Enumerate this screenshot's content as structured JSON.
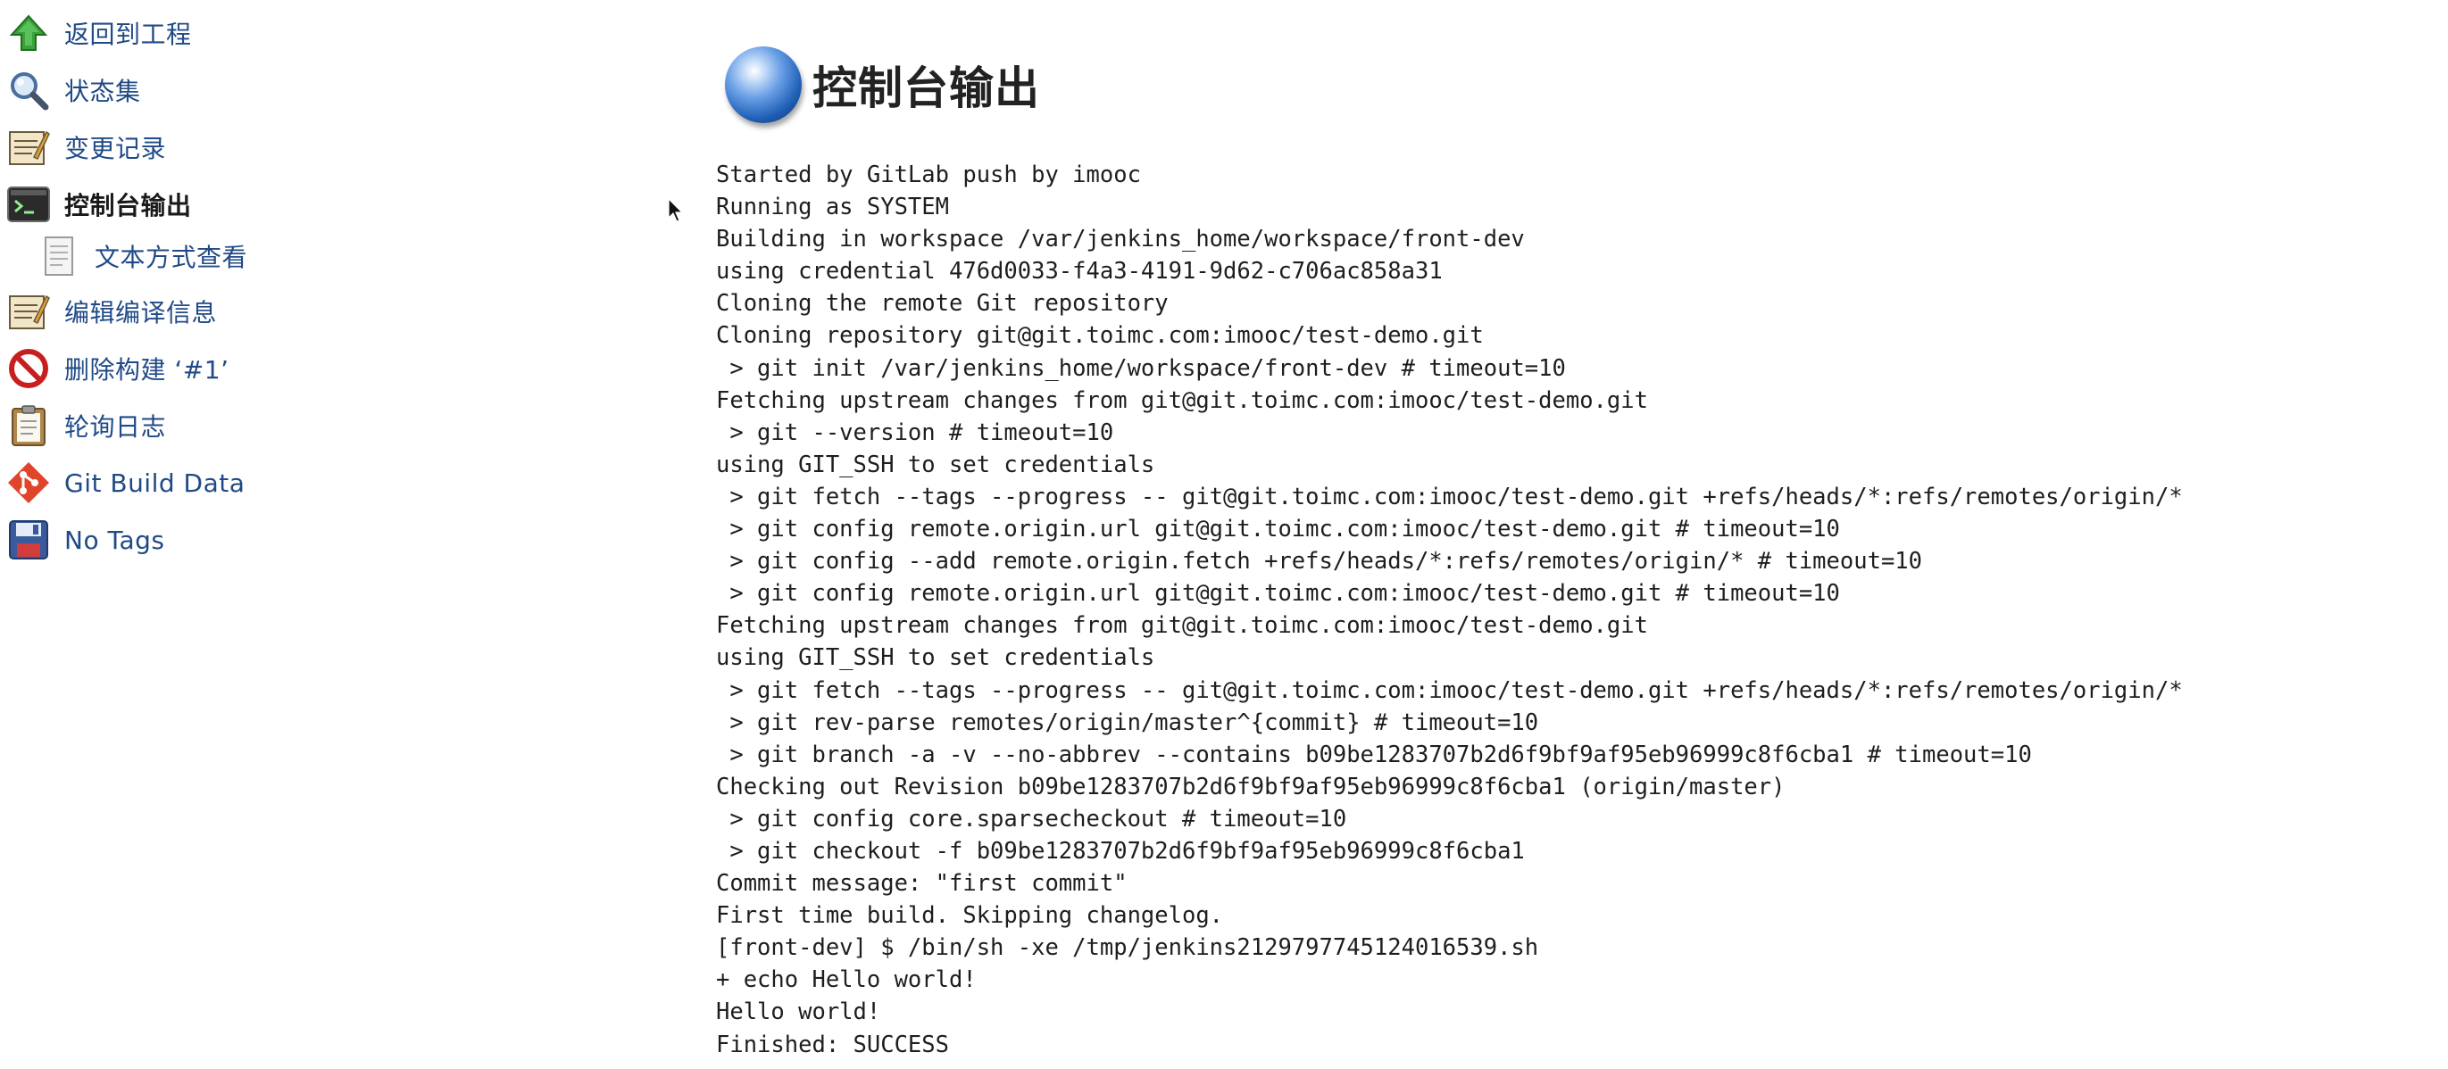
{
  "sidebar": {
    "items": [
      {
        "label": "返回到工程",
        "icon": "arrow-up-icon"
      },
      {
        "label": "状态集",
        "icon": "search-icon"
      },
      {
        "label": "变更记录",
        "icon": "notepad-icon"
      },
      {
        "label": "控制台输出",
        "icon": "terminal-icon",
        "active": true
      },
      {
        "label": "文本方式查看",
        "icon": "document-icon"
      },
      {
        "label": "编辑编译信息",
        "icon": "notepad-icon"
      },
      {
        "label": "删除构建 ‘#1’",
        "icon": "no-entry-icon"
      },
      {
        "label": "轮询日志",
        "icon": "clipboard-icon"
      },
      {
        "label": "Git Build Data",
        "icon": "git-icon"
      },
      {
        "label": "No Tags",
        "icon": "save-icon"
      }
    ]
  },
  "main": {
    "title": "控制台输出",
    "console_lines": [
      "Started by GitLab push by imooc",
      "Running as SYSTEM",
      "Building in workspace /var/jenkins_home/workspace/front-dev",
      "using credential 476d0033-f4a3-4191-9d62-c706ac858a31",
      "Cloning the remote Git repository",
      "Cloning repository git@git.toimc.com:imooc/test-demo.git",
      " > git init /var/jenkins_home/workspace/front-dev # timeout=10",
      "Fetching upstream changes from git@git.toimc.com:imooc/test-demo.git",
      " > git --version # timeout=10",
      "using GIT_SSH to set credentials",
      " > git fetch --tags --progress -- git@git.toimc.com:imooc/test-demo.git +refs/heads/*:refs/remotes/origin/*",
      " > git config remote.origin.url git@git.toimc.com:imooc/test-demo.git # timeout=10",
      " > git config --add remote.origin.fetch +refs/heads/*:refs/remotes/origin/* # timeout=10",
      " > git config remote.origin.url git@git.toimc.com:imooc/test-demo.git # timeout=10",
      "Fetching upstream changes from git@git.toimc.com:imooc/test-demo.git",
      "using GIT_SSH to set credentials",
      " > git fetch --tags --progress -- git@git.toimc.com:imooc/test-demo.git +refs/heads/*:refs/remotes/origin/*",
      " > git rev-parse remotes/origin/master^{commit} # timeout=10",
      " > git branch -a -v --no-abbrev --contains b09be1283707b2d6f9bf9af95eb96999c8f6cba1 # timeout=10",
      "Checking out Revision b09be1283707b2d6f9bf9af95eb96999c8f6cba1 (origin/master)",
      " > git config core.sparsecheckout # timeout=10",
      " > git checkout -f b09be1283707b2d6f9bf9af95eb96999c8f6cba1",
      "Commit message: \"first commit\"",
      "First time build. Skipping changelog.",
      "[front-dev] $ /bin/sh -xe /tmp/jenkins2129797745124016539.sh",
      "+ echo Hello world!",
      "Hello world!",
      "Finished: SUCCESS"
    ]
  },
  "colors": {
    "link": "#204a87",
    "text": "#1e1e1e",
    "background": "#ffffff"
  }
}
